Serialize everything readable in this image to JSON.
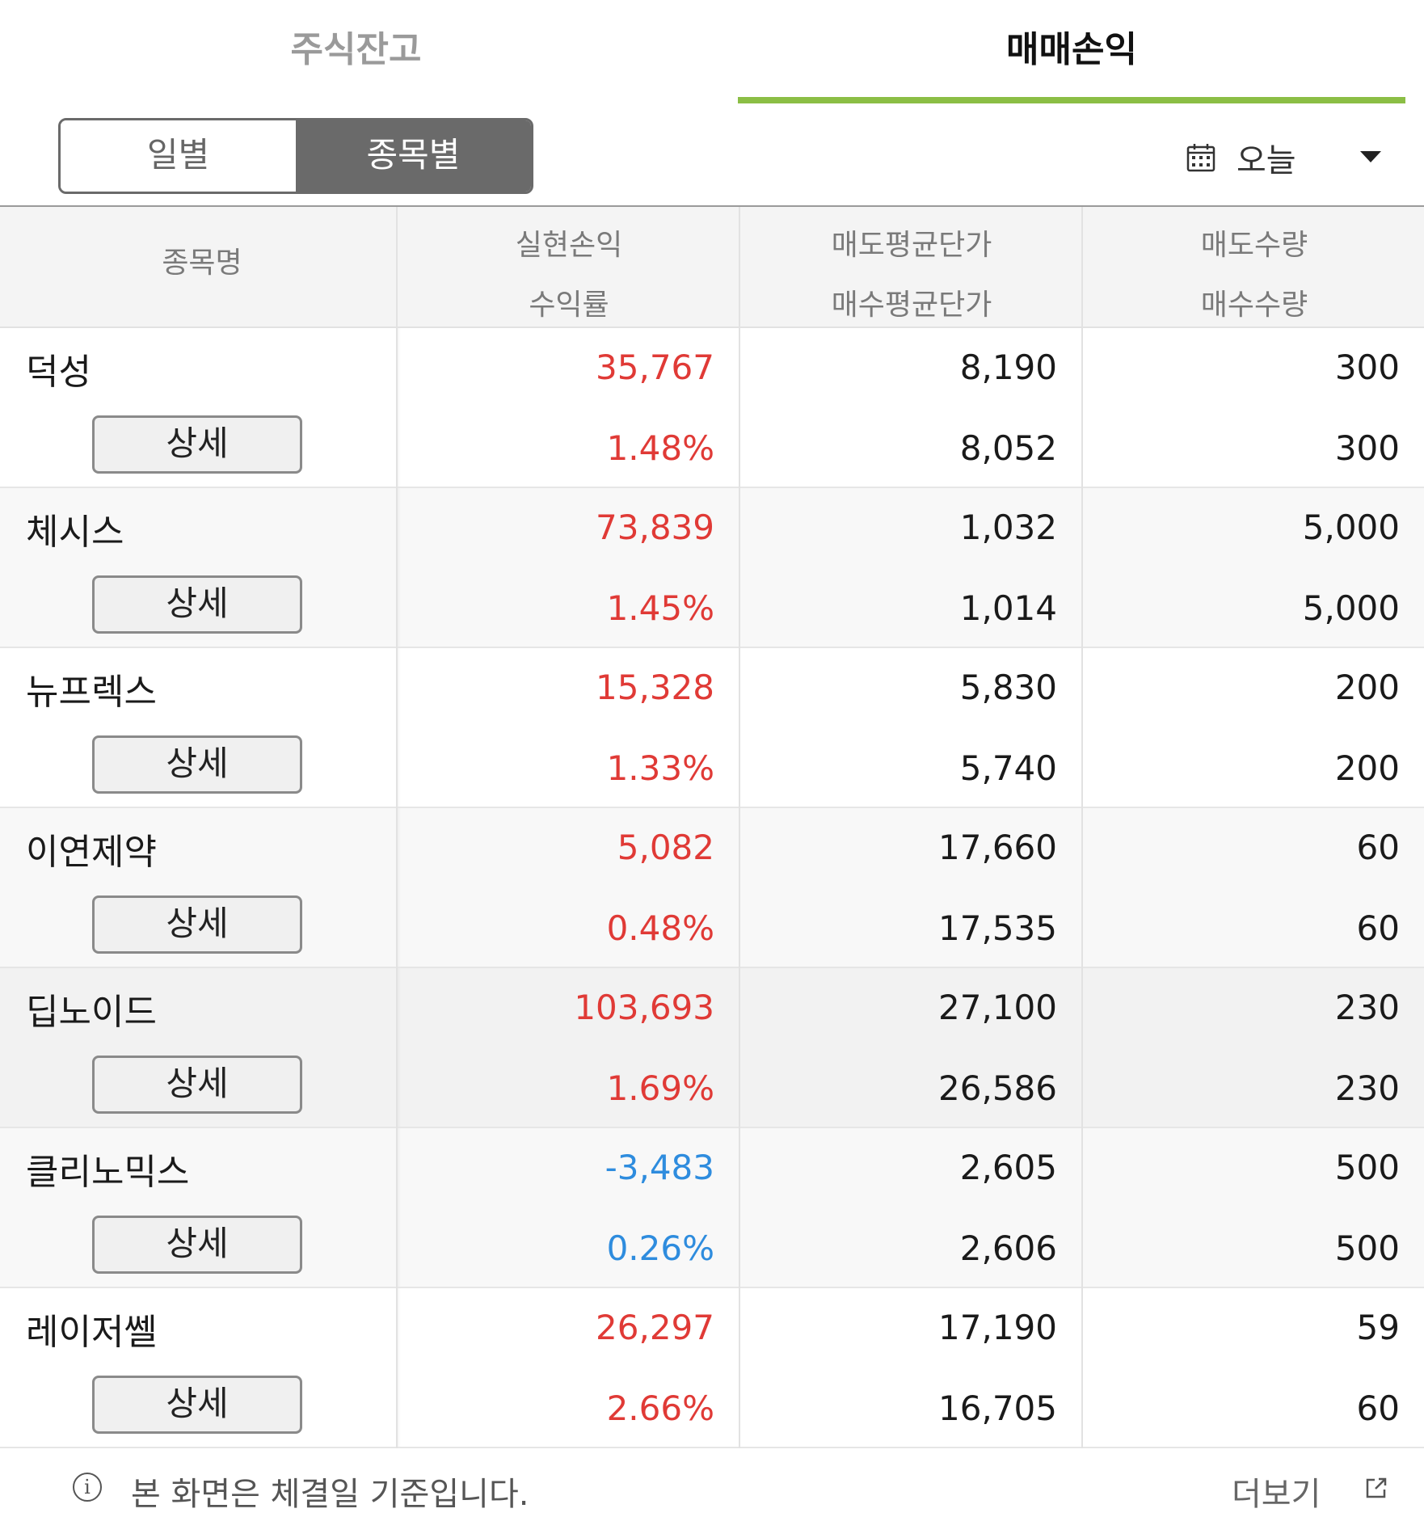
{
  "tabs": {
    "holdings": "주식잔고",
    "trading_pnl": "매매손익"
  },
  "segment": {
    "daily": "일별",
    "by_stock": "종목별"
  },
  "date_picker": {
    "label": "오늘"
  },
  "table": {
    "headers": {
      "name": "종목명",
      "col1_top": "실현손익",
      "col1_bottom": "수익률",
      "col2_top": "매도평균단가",
      "col2_bottom": "매수평균단가",
      "col3_top": "매도수량",
      "col3_bottom": "매수수량"
    },
    "detail_label": "상세",
    "rows": [
      {
        "name": "덕성",
        "realized_pnl": "35,767",
        "return_rate": "1.48%",
        "sell_avg": "8,190",
        "buy_avg": "8,052",
        "sell_qty": "300",
        "buy_qty": "300"
      },
      {
        "name": "체시스",
        "realized_pnl": "73,839",
        "return_rate": "1.45%",
        "sell_avg": "1,032",
        "buy_avg": "1,014",
        "sell_qty": "5,000",
        "buy_qty": "5,000"
      },
      {
        "name": "뉴프렉스",
        "realized_pnl": "15,328",
        "return_rate": "1.33%",
        "sell_avg": "5,830",
        "buy_avg": "5,740",
        "sell_qty": "200",
        "buy_qty": "200"
      },
      {
        "name": "이연제약",
        "realized_pnl": "5,082",
        "return_rate": "0.48%",
        "sell_avg": "17,660",
        "buy_avg": "17,535",
        "sell_qty": "60",
        "buy_qty": "60"
      },
      {
        "name": "딥노이드",
        "realized_pnl": "103,693",
        "return_rate": "1.69%",
        "sell_avg": "27,100",
        "buy_avg": "26,586",
        "sell_qty": "230",
        "buy_qty": "230"
      },
      {
        "name": "클리노믹스",
        "realized_pnl": "-3,483",
        "return_rate": "0.26%",
        "sell_avg": "2,605",
        "buy_avg": "2,606",
        "sell_qty": "500",
        "buy_qty": "500"
      },
      {
        "name": "레이저쎌",
        "realized_pnl": "26,297",
        "return_rate": "2.66%",
        "sell_avg": "17,190",
        "buy_avg": "16,705",
        "sell_qty": "59",
        "buy_qty": "60"
      }
    ]
  },
  "footer": {
    "notice": "본 화면은 체결일 기준입니다.",
    "more": "더보기"
  },
  "colors": {
    "accent": "#8bbe45",
    "profit": "#e03a36",
    "loss": "#2e8cde"
  }
}
